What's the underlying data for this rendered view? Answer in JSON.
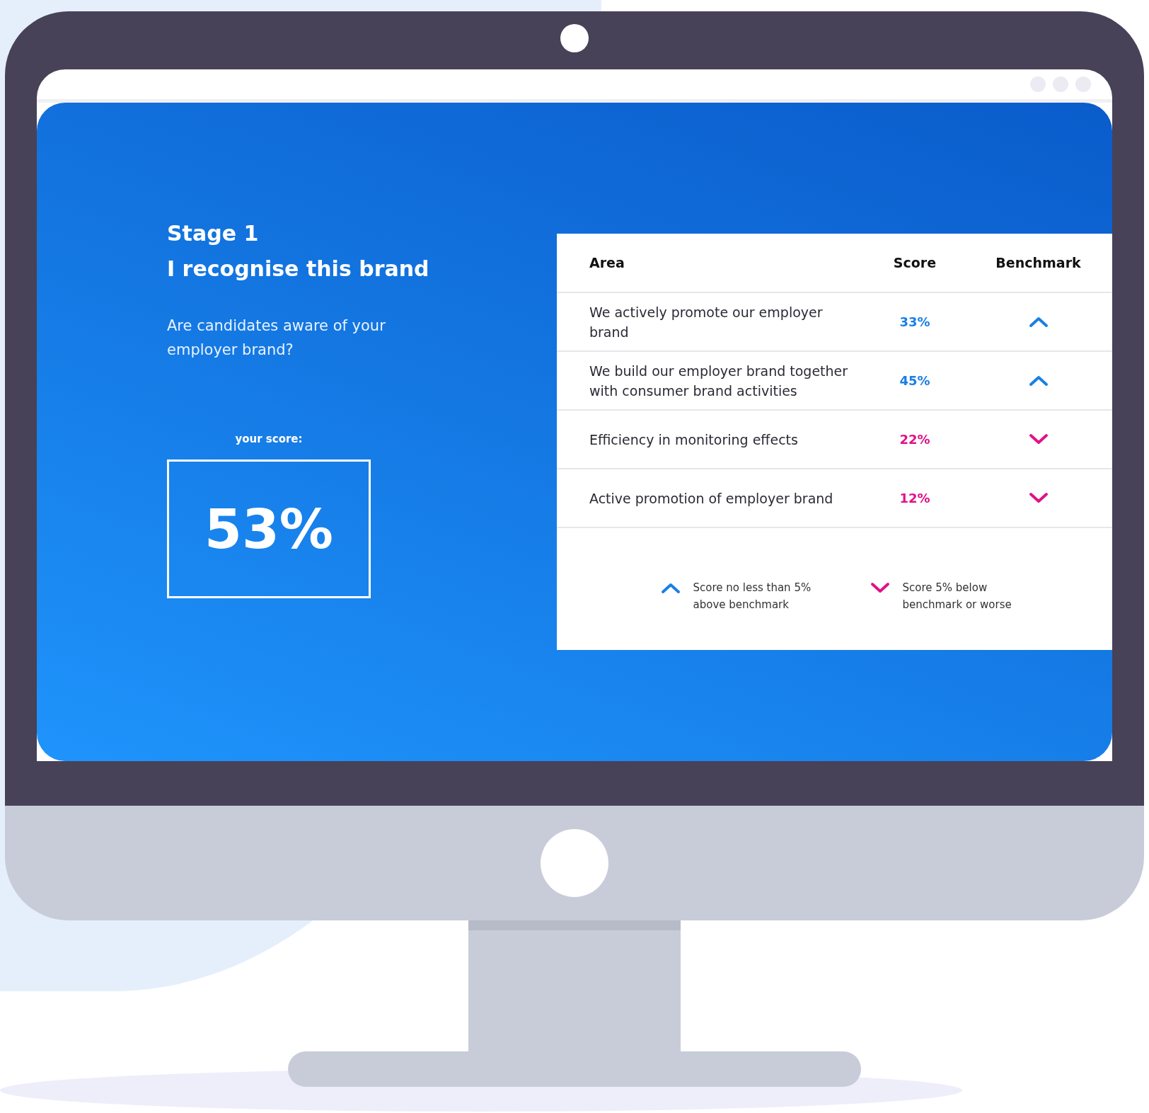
{
  "stage": "Stage 1",
  "title": "I recognise this brand",
  "question": "Are candidates aware of your employer brand?",
  "score_label": "your score:",
  "score": "53%",
  "table": {
    "columns": [
      "Area",
      "Score",
      "Benchmark"
    ],
    "rows": [
      {
        "area": "We actively promote our employer brand",
        "score": "33%",
        "above_benchmark": true
      },
      {
        "area": "We build our employer brand together with consumer brand activities",
        "score": "45%",
        "above_benchmark": true
      },
      {
        "area": "Efficiency in monitoring effects",
        "score": "22%",
        "above_benchmark": false
      },
      {
        "area": "Active promotion of employer brand",
        "score": "12%",
        "above_benchmark": false
      }
    ]
  },
  "legend": [
    {
      "kind": "above",
      "text": "Score no less than 5% above benchmark"
    },
    {
      "kind": "below",
      "text": "Score 5% below benchmark or worse"
    }
  ]
}
